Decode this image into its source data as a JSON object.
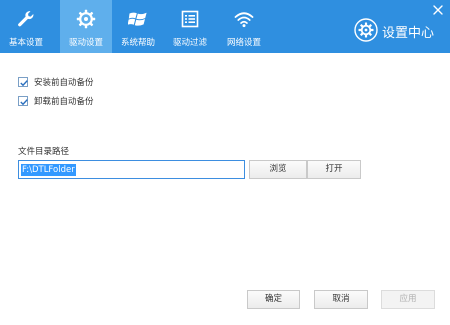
{
  "tabs": [
    {
      "label": "基本设置",
      "icon": "wrench-icon"
    },
    {
      "label": "驱动设置",
      "icon": "gear-icon"
    },
    {
      "label": "系统帮助",
      "icon": "windows-icon"
    },
    {
      "label": "驱动过滤",
      "icon": "list-icon"
    },
    {
      "label": "网络设置",
      "icon": "wifi-icon"
    }
  ],
  "active_tab": "驱动设置",
  "brand": {
    "title": "设置中心",
    "icon": "gear-icon"
  },
  "options": [
    {
      "label": "安装前自动备份",
      "checked": true
    },
    {
      "label": "卸载前自动备份",
      "checked": true
    }
  ],
  "path": {
    "label": "文件目录路径",
    "value": "F:\\DTLFolder"
  },
  "buttons": {
    "browse": "浏览",
    "open": "打开",
    "ok": "确定",
    "cancel": "取消",
    "apply": "应用"
  },
  "colors": {
    "header": "#2f8fe0",
    "active_tab": "#5fafec",
    "accent": "#3d8ee0"
  }
}
